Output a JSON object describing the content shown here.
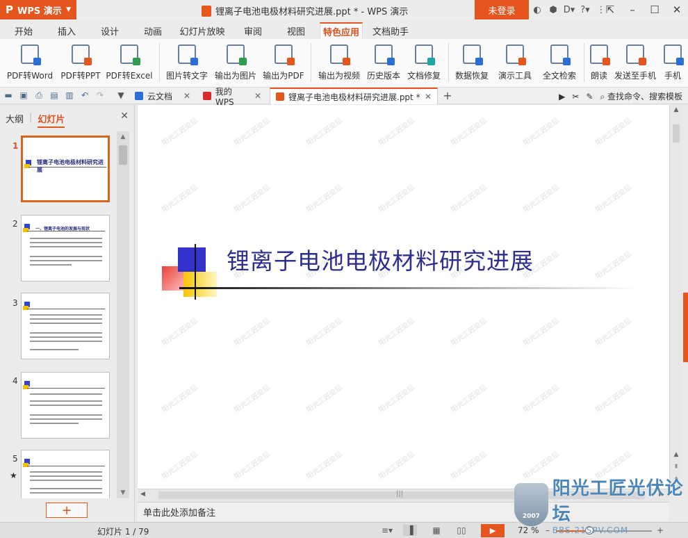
{
  "titlebar": {
    "app_name": "WPS 演示",
    "logo": "P",
    "window_title": "锂离子电池电极材料研究进展.ppt * - WPS 演示",
    "login": "未登录"
  },
  "menu_tabs": [
    "开始",
    "插入",
    "设计",
    "动画",
    "幻灯片放映",
    "审阅",
    "视图",
    "特色应用",
    "文档助手"
  ],
  "active_menu_tab": "特色应用",
  "ribbon": {
    "items": [
      {
        "label": "PDF转Word",
        "icon": "pdf-to-word-icon"
      },
      {
        "label": "PDF转PPT",
        "icon": "pdf-to-ppt-icon"
      },
      {
        "label": "PDF转Excel",
        "icon": "pdf-to-excel-icon"
      },
      {
        "label": "图片转文字",
        "icon": "ocr-icon"
      },
      {
        "label": "输出为图片",
        "icon": "export-image-icon"
      },
      {
        "label": "输出为PDF",
        "icon": "export-pdf-icon"
      },
      {
        "label": "输出为视频",
        "icon": "export-video-icon"
      },
      {
        "label": "历史版本",
        "icon": "history-icon"
      },
      {
        "label": "文档修复",
        "icon": "repair-icon"
      },
      {
        "label": "数据恢复",
        "icon": "recover-icon"
      },
      {
        "label": "演示工具",
        "icon": "present-tools-icon"
      },
      {
        "label": "全文检索",
        "icon": "search-doc-icon"
      },
      {
        "label": "朗读",
        "icon": "read-aloud-icon"
      },
      {
        "label": "发送至手机",
        "icon": "send-phone-icon"
      },
      {
        "label": "手机",
        "icon": "phone-icon"
      }
    ],
    "colors": {
      "word": "#2b6fd6",
      "orange": "#e5561f",
      "green": "#2f9b4e",
      "teal": "#1ea6a6"
    }
  },
  "doc_tabs": [
    {
      "label": "云文档",
      "icon": "cloud-icon"
    },
    {
      "label": "我的WPS",
      "icon": "wps-icon"
    },
    {
      "label": "锂离子电池电极材料研究进展.ppt *",
      "icon": "ppt-icon"
    }
  ],
  "doc_search": "查找命令、搜索模板",
  "left_panel": {
    "tab_outline": "大纲",
    "tab_slides": "幻灯片",
    "slide_numbers": [
      "1",
      "2",
      "3",
      "4",
      "5"
    ],
    "thumb_titles": [
      "锂离子电池电极材料研究进展",
      "一、锂离子电池的发展与现状"
    ]
  },
  "slide": {
    "title": "锂离子电池电极材料研究进展"
  },
  "watermark_text": "阳光工匠论坛",
  "notes_placeholder": "单击此处添加备注",
  "statusbar": {
    "slide_count": "幻灯片 1 / 79",
    "zoom": "72 %"
  },
  "forum": {
    "name": "阳光工匠光伏论坛",
    "url": "BBS.21SPV.COM",
    "year": "2007"
  },
  "accent": "#e5561f"
}
